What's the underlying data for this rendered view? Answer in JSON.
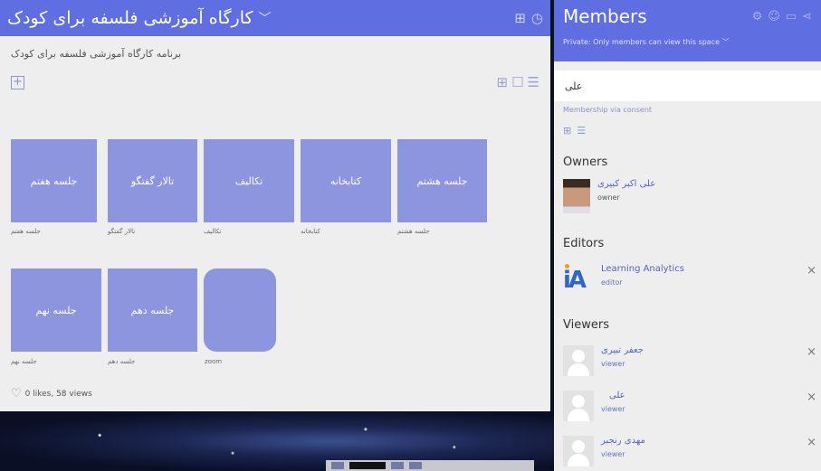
{
  "space": {
    "title": "کارگاه آموزشی فلسفه برای کودک",
    "description": "برنامه کارگاه آموزشی فلسفه برای کودک",
    "likes_views": "0 likes, 58 views",
    "tiles": [
      {
        "label": "جلسه هفتم",
        "caption": "جلسه هفتم"
      },
      {
        "label": "تالار گفتگو",
        "caption": "تالار گفتگو"
      },
      {
        "label": "تکالیف",
        "caption": "تکالیف"
      },
      {
        "label": "کتابخانه",
        "caption": "کتابخانه"
      },
      {
        "label": "جلسه هشتم",
        "caption": "جلسه هشتم"
      },
      {
        "label": "جلسه نهم",
        "caption": "جلسه نهم"
      },
      {
        "label": "جلسه دهم",
        "caption": "جلسه دهم"
      },
      {
        "label": "",
        "caption": "zoom"
      }
    ]
  },
  "members": {
    "title": "Members",
    "privacy": "Private: Only members can view this space",
    "search_value": "علی",
    "membership": "Membership via consent",
    "owners_heading": "Owners",
    "editors_heading": "Editors",
    "viewers_heading": "Viewers",
    "owner": {
      "name": "علی اکبر کبیری",
      "role": "owner"
    },
    "editor": {
      "name": "Learning Analytics",
      "role": "editor",
      "logo_text": "iA"
    },
    "viewers": [
      {
        "name": "جعفر تبیری",
        "role": "viewer"
      },
      {
        "name": "علی",
        "role": "viewer"
      },
      {
        "name": "مهدی رنجبر",
        "role": "viewer"
      }
    ]
  },
  "colors": {
    "header": "#5f6ee0",
    "tile": "#8e95df",
    "link": "#5563c9"
  },
  "icons": {
    "remove": "×",
    "chevron": "﹀",
    "add": "+",
    "heart": "♡"
  }
}
